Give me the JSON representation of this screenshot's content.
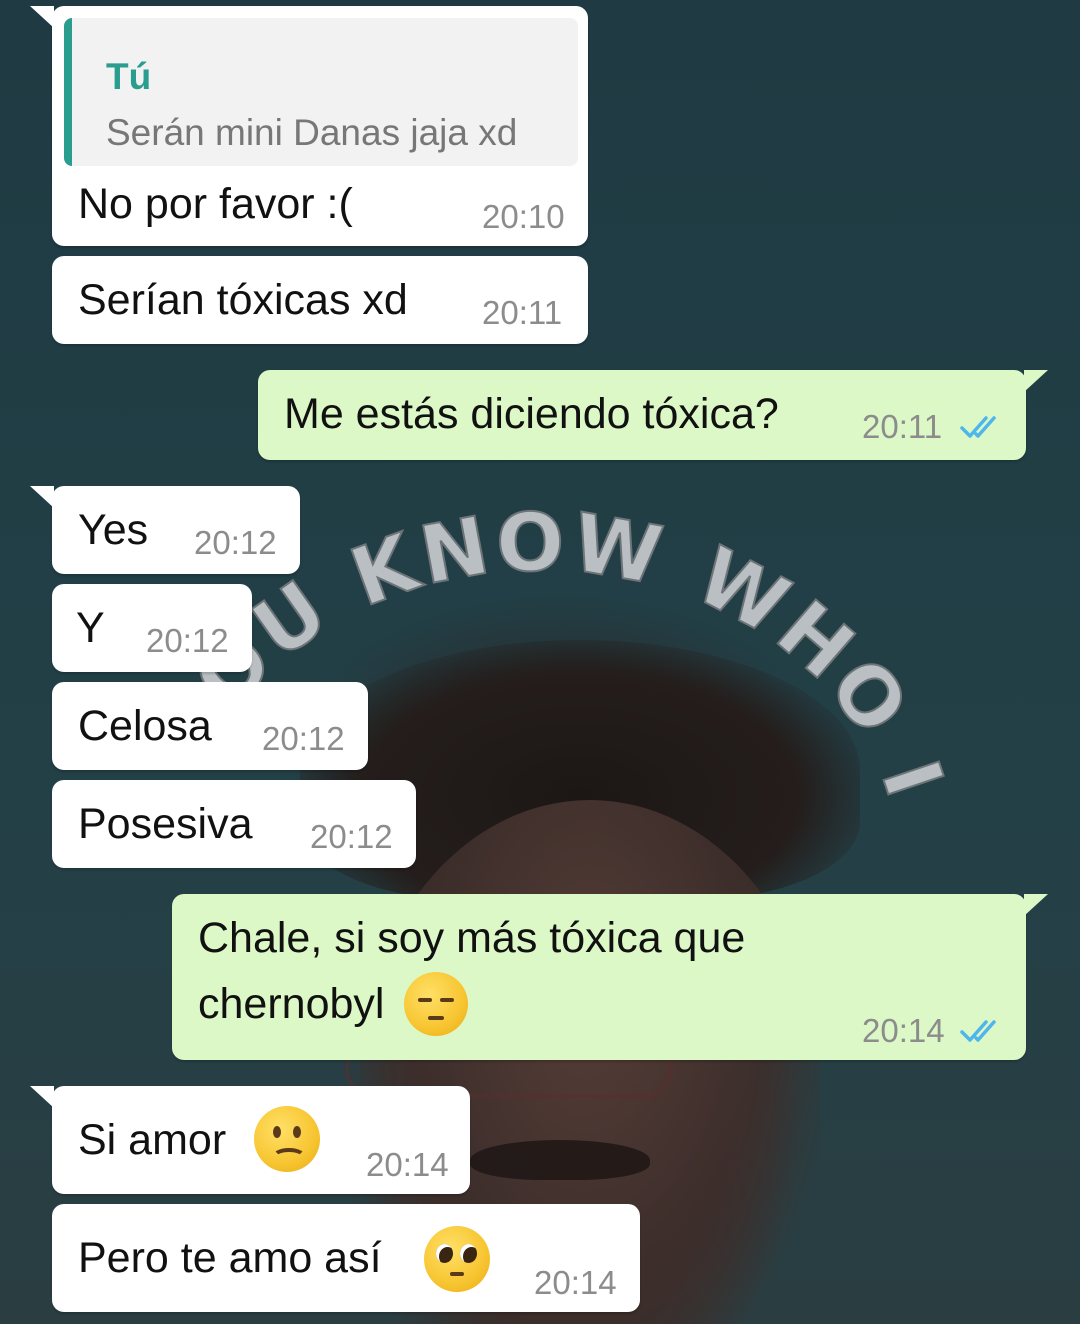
{
  "wallpaper": {
    "watermark_text": "YOU KNOW WHO I AM"
  },
  "colors": {
    "incoming_bubble": "#ffffff",
    "outgoing_bubble": "#dcf8c6",
    "quote_accent": "#2a9d8f",
    "read_ticks": "#4fb6ec",
    "background": "#213d45"
  },
  "messages": [
    {
      "direction": "incoming",
      "quote": {
        "author": "Tú",
        "text": "Serán mini Danas jaja xd"
      },
      "text": "No por favor :(",
      "time": "20:10"
    },
    {
      "direction": "incoming",
      "text": "Serían tóxicas xd",
      "time": "20:11"
    },
    {
      "direction": "outgoing",
      "text": "Me estás diciendo tóxica?",
      "time": "20:11",
      "status": "read"
    },
    {
      "direction": "incoming",
      "text": "Yes",
      "time": "20:12"
    },
    {
      "direction": "incoming",
      "text": "Y",
      "time": "20:12"
    },
    {
      "direction": "incoming",
      "text": "Celosa",
      "time": "20:12"
    },
    {
      "direction": "incoming",
      "text": "Posesiva",
      "time": "20:12"
    },
    {
      "direction": "outgoing",
      "text_line1": "Chale, si soy más tóxica que",
      "text_line2": "chernobyl",
      "emoji": "pensive-face-emoji",
      "time": "20:14",
      "status": "read"
    },
    {
      "direction": "incoming",
      "text": "Si amor",
      "emoji": "frowning-face-emoji",
      "time": "20:14"
    },
    {
      "direction": "incoming",
      "text": "Pero te amo así",
      "emoji": "pleading-face-emoji",
      "time": "20:14"
    }
  ]
}
